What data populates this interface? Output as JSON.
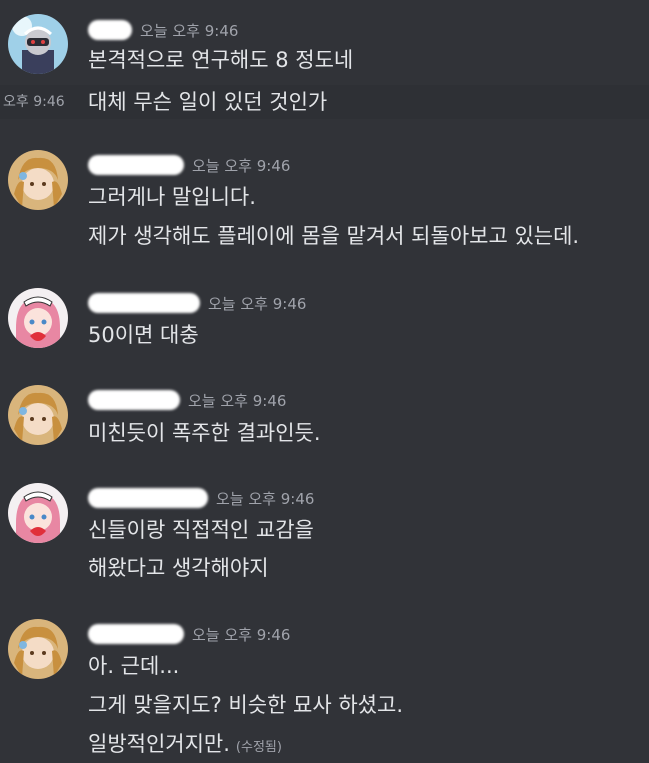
{
  "messages": [
    {
      "timestamp": "오늘 오후 9:46",
      "lines": [
        "본격적으로 연구해도 8 정도네"
      ]
    },
    {
      "hover_timestamp": "오후 9:46",
      "lines": [
        "대체 무슨 일이 있던 것인가"
      ]
    },
    {
      "timestamp": "오늘 오후 9:46",
      "lines": [
        "그러게나 말입니다.",
        "제가 생각해도 플레이에 몸을 맡겨서 되돌아보고 있는데."
      ]
    },
    {
      "timestamp": "오늘 오후 9:46",
      "lines": [
        "50이면 대충"
      ]
    },
    {
      "timestamp": "오늘 오후 9:46",
      "lines": [
        "미친듯이 폭주한 결과인듯."
      ]
    },
    {
      "timestamp": "오늘 오후 9:46",
      "lines": [
        "신들이랑 직접적인 교감을",
        "해왔다고 생각해야지"
      ]
    },
    {
      "timestamp": "오늘 오후 9:46",
      "lines": [
        "아. 근데...",
        "그게 맞을지도? 비슷한 묘사 하셨고.",
        "일방적인거지만."
      ],
      "edited": "(수정됨)"
    }
  ],
  "colors": {
    "background": "#313338",
    "hover_row": "#2e3035",
    "message_text": "#e3e5e8",
    "timestamp_text": "#a0a3ab",
    "redaction": "#ffffff"
  },
  "icons": [
    "avatar-masked-figure",
    "avatar-blonde-character",
    "avatar-pink-hair-maid-character"
  ]
}
